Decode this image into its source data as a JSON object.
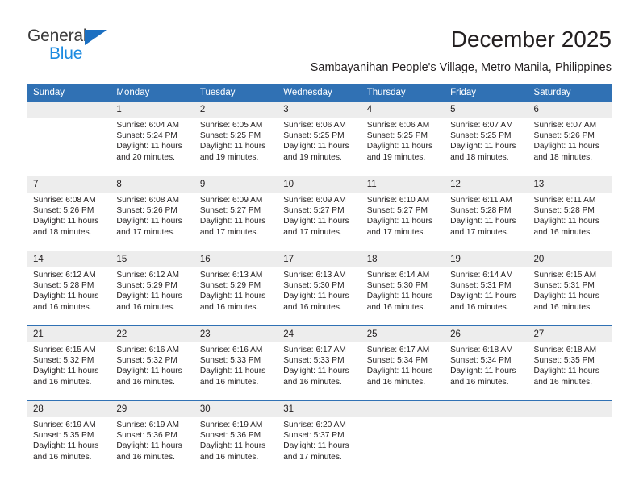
{
  "logo": {
    "word_top": "General",
    "word_bottom": "Blue",
    "triangle_color": "#1b6fc1",
    "top_color": "#3b3b3b",
    "bottom_color": "#1b8ae0"
  },
  "header": {
    "title": "December 2025",
    "subtitle": "Sambayanihan People's Village, Metro Manila, Philippines"
  },
  "theme": {
    "header_blue": "#3071b4",
    "daynum_gray": "#ededed",
    "text": "#231f20"
  },
  "weekday_headers": [
    "Sunday",
    "Monday",
    "Tuesday",
    "Wednesday",
    "Thursday",
    "Friday",
    "Saturday"
  ],
  "weeks": [
    {
      "days": [
        {
          "num": "",
          "sunrise": "",
          "sunset": "",
          "daylight1": "",
          "daylight2": ""
        },
        {
          "num": "1",
          "sunrise": "Sunrise: 6:04 AM",
          "sunset": "Sunset: 5:24 PM",
          "daylight1": "Daylight: 11 hours",
          "daylight2": "and 20 minutes."
        },
        {
          "num": "2",
          "sunrise": "Sunrise: 6:05 AM",
          "sunset": "Sunset: 5:25 PM",
          "daylight1": "Daylight: 11 hours",
          "daylight2": "and 19 minutes."
        },
        {
          "num": "3",
          "sunrise": "Sunrise: 6:06 AM",
          "sunset": "Sunset: 5:25 PM",
          "daylight1": "Daylight: 11 hours",
          "daylight2": "and 19 minutes."
        },
        {
          "num": "4",
          "sunrise": "Sunrise: 6:06 AM",
          "sunset": "Sunset: 5:25 PM",
          "daylight1": "Daylight: 11 hours",
          "daylight2": "and 19 minutes."
        },
        {
          "num": "5",
          "sunrise": "Sunrise: 6:07 AM",
          "sunset": "Sunset: 5:25 PM",
          "daylight1": "Daylight: 11 hours",
          "daylight2": "and 18 minutes."
        },
        {
          "num": "6",
          "sunrise": "Sunrise: 6:07 AM",
          "sunset": "Sunset: 5:26 PM",
          "daylight1": "Daylight: 11 hours",
          "daylight2": "and 18 minutes."
        }
      ]
    },
    {
      "days": [
        {
          "num": "7",
          "sunrise": "Sunrise: 6:08 AM",
          "sunset": "Sunset: 5:26 PM",
          "daylight1": "Daylight: 11 hours",
          "daylight2": "and 18 minutes."
        },
        {
          "num": "8",
          "sunrise": "Sunrise: 6:08 AM",
          "sunset": "Sunset: 5:26 PM",
          "daylight1": "Daylight: 11 hours",
          "daylight2": "and 17 minutes."
        },
        {
          "num": "9",
          "sunrise": "Sunrise: 6:09 AM",
          "sunset": "Sunset: 5:27 PM",
          "daylight1": "Daylight: 11 hours",
          "daylight2": "and 17 minutes."
        },
        {
          "num": "10",
          "sunrise": "Sunrise: 6:09 AM",
          "sunset": "Sunset: 5:27 PM",
          "daylight1": "Daylight: 11 hours",
          "daylight2": "and 17 minutes."
        },
        {
          "num": "11",
          "sunrise": "Sunrise: 6:10 AM",
          "sunset": "Sunset: 5:27 PM",
          "daylight1": "Daylight: 11 hours",
          "daylight2": "and 17 minutes."
        },
        {
          "num": "12",
          "sunrise": "Sunrise: 6:11 AM",
          "sunset": "Sunset: 5:28 PM",
          "daylight1": "Daylight: 11 hours",
          "daylight2": "and 17 minutes."
        },
        {
          "num": "13",
          "sunrise": "Sunrise: 6:11 AM",
          "sunset": "Sunset: 5:28 PM",
          "daylight1": "Daylight: 11 hours",
          "daylight2": "and 16 minutes."
        }
      ]
    },
    {
      "days": [
        {
          "num": "14",
          "sunrise": "Sunrise: 6:12 AM",
          "sunset": "Sunset: 5:28 PM",
          "daylight1": "Daylight: 11 hours",
          "daylight2": "and 16 minutes."
        },
        {
          "num": "15",
          "sunrise": "Sunrise: 6:12 AM",
          "sunset": "Sunset: 5:29 PM",
          "daylight1": "Daylight: 11 hours",
          "daylight2": "and 16 minutes."
        },
        {
          "num": "16",
          "sunrise": "Sunrise: 6:13 AM",
          "sunset": "Sunset: 5:29 PM",
          "daylight1": "Daylight: 11 hours",
          "daylight2": "and 16 minutes."
        },
        {
          "num": "17",
          "sunrise": "Sunrise: 6:13 AM",
          "sunset": "Sunset: 5:30 PM",
          "daylight1": "Daylight: 11 hours",
          "daylight2": "and 16 minutes."
        },
        {
          "num": "18",
          "sunrise": "Sunrise: 6:14 AM",
          "sunset": "Sunset: 5:30 PM",
          "daylight1": "Daylight: 11 hours",
          "daylight2": "and 16 minutes."
        },
        {
          "num": "19",
          "sunrise": "Sunrise: 6:14 AM",
          "sunset": "Sunset: 5:31 PM",
          "daylight1": "Daylight: 11 hours",
          "daylight2": "and 16 minutes."
        },
        {
          "num": "20",
          "sunrise": "Sunrise: 6:15 AM",
          "sunset": "Sunset: 5:31 PM",
          "daylight1": "Daylight: 11 hours",
          "daylight2": "and 16 minutes."
        }
      ]
    },
    {
      "days": [
        {
          "num": "21",
          "sunrise": "Sunrise: 6:15 AM",
          "sunset": "Sunset: 5:32 PM",
          "daylight1": "Daylight: 11 hours",
          "daylight2": "and 16 minutes."
        },
        {
          "num": "22",
          "sunrise": "Sunrise: 6:16 AM",
          "sunset": "Sunset: 5:32 PM",
          "daylight1": "Daylight: 11 hours",
          "daylight2": "and 16 minutes."
        },
        {
          "num": "23",
          "sunrise": "Sunrise: 6:16 AM",
          "sunset": "Sunset: 5:33 PM",
          "daylight1": "Daylight: 11 hours",
          "daylight2": "and 16 minutes."
        },
        {
          "num": "24",
          "sunrise": "Sunrise: 6:17 AM",
          "sunset": "Sunset: 5:33 PM",
          "daylight1": "Daylight: 11 hours",
          "daylight2": "and 16 minutes."
        },
        {
          "num": "25",
          "sunrise": "Sunrise: 6:17 AM",
          "sunset": "Sunset: 5:34 PM",
          "daylight1": "Daylight: 11 hours",
          "daylight2": "and 16 minutes."
        },
        {
          "num": "26",
          "sunrise": "Sunrise: 6:18 AM",
          "sunset": "Sunset: 5:34 PM",
          "daylight1": "Daylight: 11 hours",
          "daylight2": "and 16 minutes."
        },
        {
          "num": "27",
          "sunrise": "Sunrise: 6:18 AM",
          "sunset": "Sunset: 5:35 PM",
          "daylight1": "Daylight: 11 hours",
          "daylight2": "and 16 minutes."
        }
      ]
    },
    {
      "days": [
        {
          "num": "28",
          "sunrise": "Sunrise: 6:19 AM",
          "sunset": "Sunset: 5:35 PM",
          "daylight1": "Daylight: 11 hours",
          "daylight2": "and 16 minutes."
        },
        {
          "num": "29",
          "sunrise": "Sunrise: 6:19 AM",
          "sunset": "Sunset: 5:36 PM",
          "daylight1": "Daylight: 11 hours",
          "daylight2": "and 16 minutes."
        },
        {
          "num": "30",
          "sunrise": "Sunrise: 6:19 AM",
          "sunset": "Sunset: 5:36 PM",
          "daylight1": "Daylight: 11 hours",
          "daylight2": "and 16 minutes."
        },
        {
          "num": "31",
          "sunrise": "Sunrise: 6:20 AM",
          "sunset": "Sunset: 5:37 PM",
          "daylight1": "Daylight: 11 hours",
          "daylight2": "and 17 minutes."
        },
        {
          "num": "",
          "sunrise": "",
          "sunset": "",
          "daylight1": "",
          "daylight2": ""
        },
        {
          "num": "",
          "sunrise": "",
          "sunset": "",
          "daylight1": "",
          "daylight2": ""
        },
        {
          "num": "",
          "sunrise": "",
          "sunset": "",
          "daylight1": "",
          "daylight2": ""
        }
      ]
    }
  ]
}
